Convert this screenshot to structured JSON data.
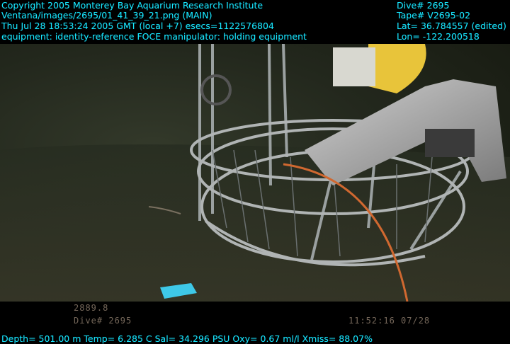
{
  "header": {
    "copyright": "Copyright 2005 Monterey Bay Aquarium Research Institute",
    "image_path": "Ventana/images/2695/01_41_39_21.png (MAIN)",
    "datetime": "Thu Jul 28 18:53:24 2005 GMT (local +7)  esecs=1122576804",
    "equipment": "equipment: identity-reference FOCE manipulator: holding equipment",
    "dive": "Dive# 2695",
    "tape": "Tape# V2695-02",
    "lat": "Lat= 36.784557 (edited)",
    "lon": "Lon= -122.200518"
  },
  "burned_in": {
    "dive_label": "Dive# 2695",
    "depth_code": "2889.8",
    "timecode": "11:52:16 07/28"
  },
  "footer": {
    "sensors": "Depth= 501.00 m  Temp= 6.285 C  Sal= 34.296 PSU  Oxy= 0.67 ml/l  Xmiss= 88.07%"
  },
  "colors": {
    "overlay_text": "#18e8ff",
    "background": "#000000",
    "seafloor": "#23281d",
    "robot_arm": "#b8b8b8",
    "yellow_disc": "#e8c43a",
    "cyan_box": "#3ec8e8"
  }
}
